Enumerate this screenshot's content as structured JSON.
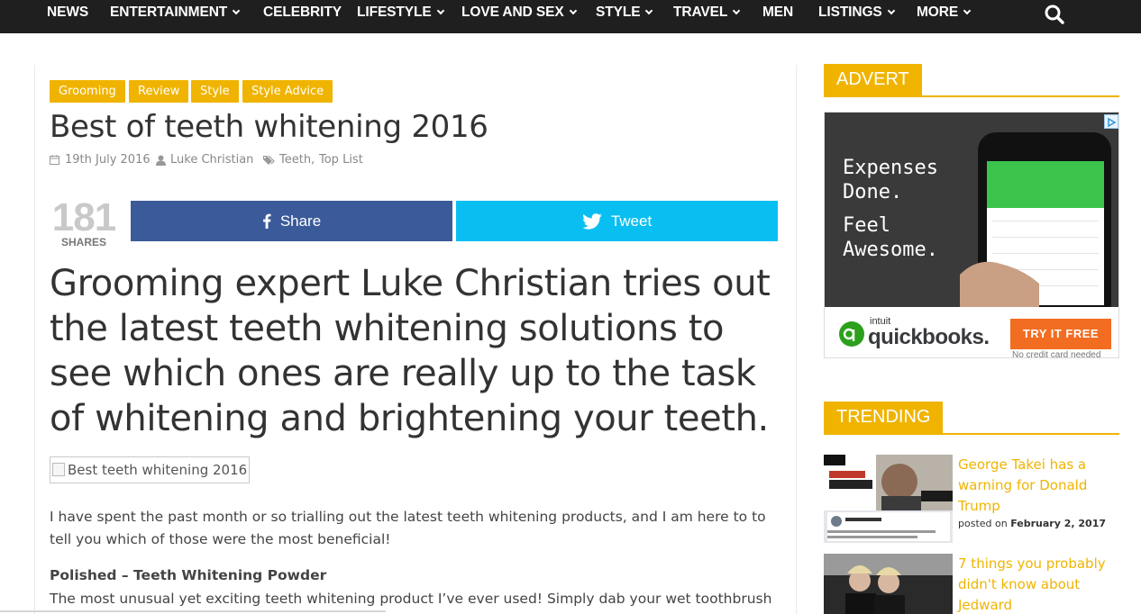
{
  "nav": {
    "items": [
      {
        "label": "NEWS",
        "dropdown": false
      },
      {
        "label": "ENTERTAINMENT",
        "dropdown": true
      },
      {
        "label": "CELEBRITY",
        "dropdown": false
      },
      {
        "label": "LIFESTYLE",
        "dropdown": true
      },
      {
        "label": "LOVE AND SEX",
        "dropdown": true
      },
      {
        "label": "STYLE",
        "dropdown": true
      },
      {
        "label": "TRAVEL",
        "dropdown": true
      },
      {
        "label": "MEN",
        "dropdown": false
      },
      {
        "label": "LISTINGS",
        "dropdown": true
      },
      {
        "label": "MORE",
        "dropdown": true
      }
    ],
    "search_icon": "search-icon"
  },
  "article": {
    "tags": [
      "Grooming",
      "Review",
      "Style",
      "Style Advice"
    ],
    "title": "Best of teeth whitening 2016",
    "meta": {
      "date": "19th July 2016",
      "author": "Luke Christian",
      "topic1": "Teeth",
      "sep": ",",
      "topic2": "Top List"
    },
    "share": {
      "count": "181",
      "count_label": "SHARES",
      "facebook_label": "Share",
      "twitter_label": "Tweet"
    },
    "lead": "Grooming expert Luke Christian tries out the latest teeth whitening solutions to see which ones are really up to the task of whitening and brightening your teeth.",
    "image_alt": "Best teeth whitening 2016",
    "paragraph1": "I have spent the past month or so trialling out the latest teeth whitening products, and I am here to to tell you which of those were the most beneficial!",
    "subheading1": "Polished – Teeth Whitening Powder",
    "paragraph2": "The most unusual yet exciting teeth whitening product I’ve ever used! Simply dab your wet toothbrush"
  },
  "sidebar": {
    "advert": {
      "heading": "ADVERT",
      "line1": "Expenses",
      "line2": "Done.",
      "line3": "Feel",
      "line4": "Awesome.",
      "brand_small": "intuit",
      "brand": "quickbooks.",
      "cta": "TRY IT FREE",
      "disclaimer": "No credit card needed"
    },
    "trending": {
      "heading": "TRENDING",
      "items": [
        {
          "title": "George Takei has a warning for Donald Trump",
          "posted_prefix": "posted on",
          "date": "February 2, 2017"
        },
        {
          "title": "7 things you probably didn't know about Jedward"
        }
      ]
    }
  },
  "colors": {
    "accent": "#f0b400",
    "nav_bg": "#1f1f1f",
    "facebook": "#3b5a99",
    "twitter": "#09bff2",
    "cta": "#f26d21"
  }
}
